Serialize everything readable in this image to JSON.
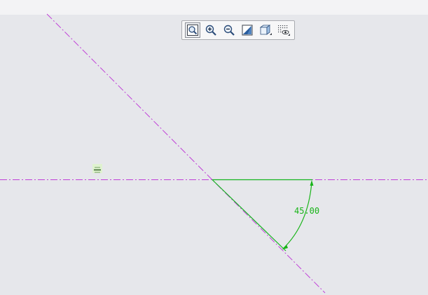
{
  "toolbar": {
    "buttons": [
      {
        "name": "refit",
        "icon": "zoom-fit-icon"
      },
      {
        "name": "zoom-in",
        "icon": "zoom-in-icon"
      },
      {
        "name": "zoom-out",
        "icon": "zoom-out-icon"
      },
      {
        "name": "repaint",
        "icon": "repaint-icon"
      },
      {
        "name": "display-style",
        "icon": "cube-shaded-icon"
      },
      {
        "name": "sketcher-display",
        "icon": "grid-eye-icon"
      }
    ]
  },
  "sketch": {
    "angle_dimension": "45.00",
    "colors": {
      "centerline": "#c040d8",
      "geometry": "#15b51f",
      "dimension": "#18b418"
    }
  }
}
